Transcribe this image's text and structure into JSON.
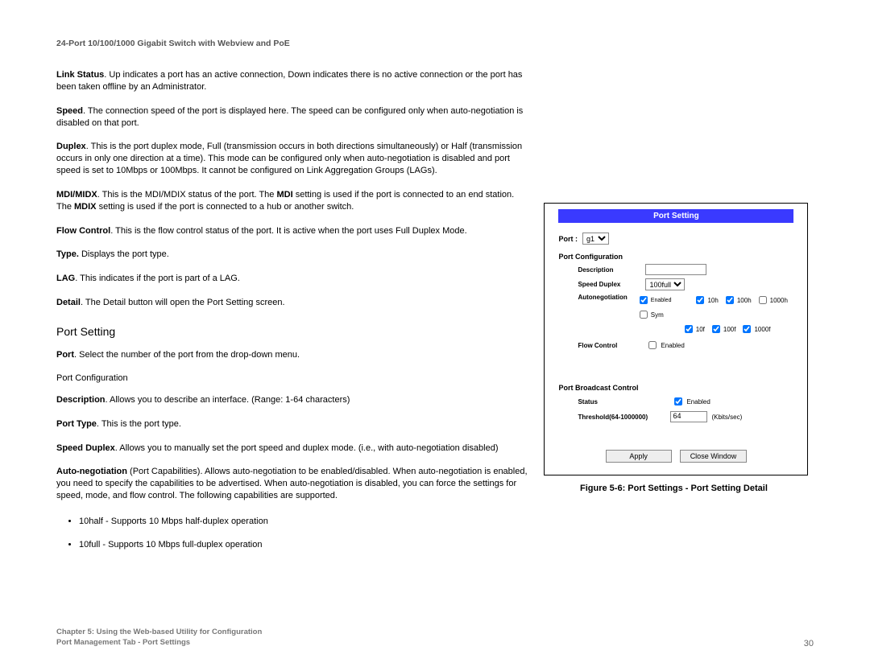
{
  "doc_title": "24-Port 10/100/1000 Gigabit Switch with Webview and PoE",
  "paragraphs": {
    "link_status": {
      "label": "Link Status",
      "text": ". Up indicates a port has an active connection, Down indicates there is no active connection or the port has been taken offline by an Administrator."
    },
    "speed": {
      "label": "Speed",
      "text": ". The connection speed of the port is displayed here. The speed can be configured only when auto-negotiation is disabled on that port."
    },
    "duplex": {
      "label": "Duplex",
      "text": ". This is the port duplex mode, Full (transmission occurs in both directions simultaneously) or Half (transmission occurs in only one direction at a time). This mode can be configured only when auto-negotiation is disabled and port speed is set to 10Mbps or 100Mbps. It cannot be configured on Link Aggregation Groups (LAGs)."
    },
    "mdi": {
      "label": "MDI/MIDX",
      "mid1": ". This is the MDI/MDIX status of the port. The ",
      "bold1": "MDI",
      "mid2": " setting is used if the port is connected to an end station. The ",
      "bold2": "MDIX",
      "mid3": " setting is used if the port is connected to a hub or another switch."
    },
    "flow_control": {
      "label": "Flow Control",
      "text": ". This is the flow control status of the port. It is active when the port uses Full Duplex Mode."
    },
    "type": {
      "label": "Type.",
      "text": " Displays the port type."
    },
    "lag": {
      "label": "LAG",
      "text": ". This indicates if the port is part of a LAG."
    },
    "detail": {
      "label": "Detail",
      "text": ". The Detail button will open the Port Setting screen."
    }
  },
  "section_heading": "Port Setting",
  "section2": {
    "port": {
      "label": "Port",
      "text": ". Select the number of the port from the drop-down menu."
    },
    "port_conf": "Port Configuration",
    "description": {
      "label": "Description",
      "text": ". Allows you to describe an interface. (Range: 1-64 characters)"
    },
    "port_type": {
      "label": "Port Type",
      "text": ". This is the port type."
    },
    "speed_duplex": {
      "label": "Speed Duplex",
      "text": ". Allows you to manually set the port speed and duplex mode. (i.e., with auto-negotiation disabled)"
    },
    "auto_neg": {
      "label": "Auto-negotiation",
      "text": " (Port Capabilities). Allows auto-negotiation to be enabled/disabled. When auto-negotiation is enabled, you need to specify the capabilities to be advertised. When auto-negotiation is disabled, you can force the settings for speed, mode, and flow control. The following capabilities are supported."
    },
    "bullets": [
      "10half - Supports 10 Mbps half-duplex operation",
      "10full - Supports 10 Mbps full-duplex operation"
    ]
  },
  "figure": {
    "panel_title": "Port Setting",
    "port_label": "Port :",
    "port_value": "g1",
    "port_conf_label": "Port Configuration",
    "description_label": "Description",
    "speed_duplex_label": "Speed Duplex",
    "speed_duplex_value": "100full",
    "auto_neg_label": "Autonegotiation",
    "enabled_label": "Enabled",
    "caps_row1": [
      "10h",
      "100h",
      "1000h",
      "Sym"
    ],
    "caps_row2": [
      "10f",
      "100f",
      "1000f"
    ],
    "flow_control_label": "Flow Control",
    "broadcast_label": "Port Broadcast Control",
    "status_label": "Status",
    "threshold_label": "Threshold(64-1000000)",
    "threshold_value": "64",
    "threshold_units": "(Kbits/sec)",
    "apply_label": "Apply",
    "close_label": "Close Window",
    "caption": "Figure 5-6: Port Settings - Port Setting Detail"
  },
  "footer": {
    "line1": "Chapter 5: Using the Web-based Utility for Configuration",
    "line2": "Port Management Tab - Port Settings",
    "page_no": "30"
  }
}
